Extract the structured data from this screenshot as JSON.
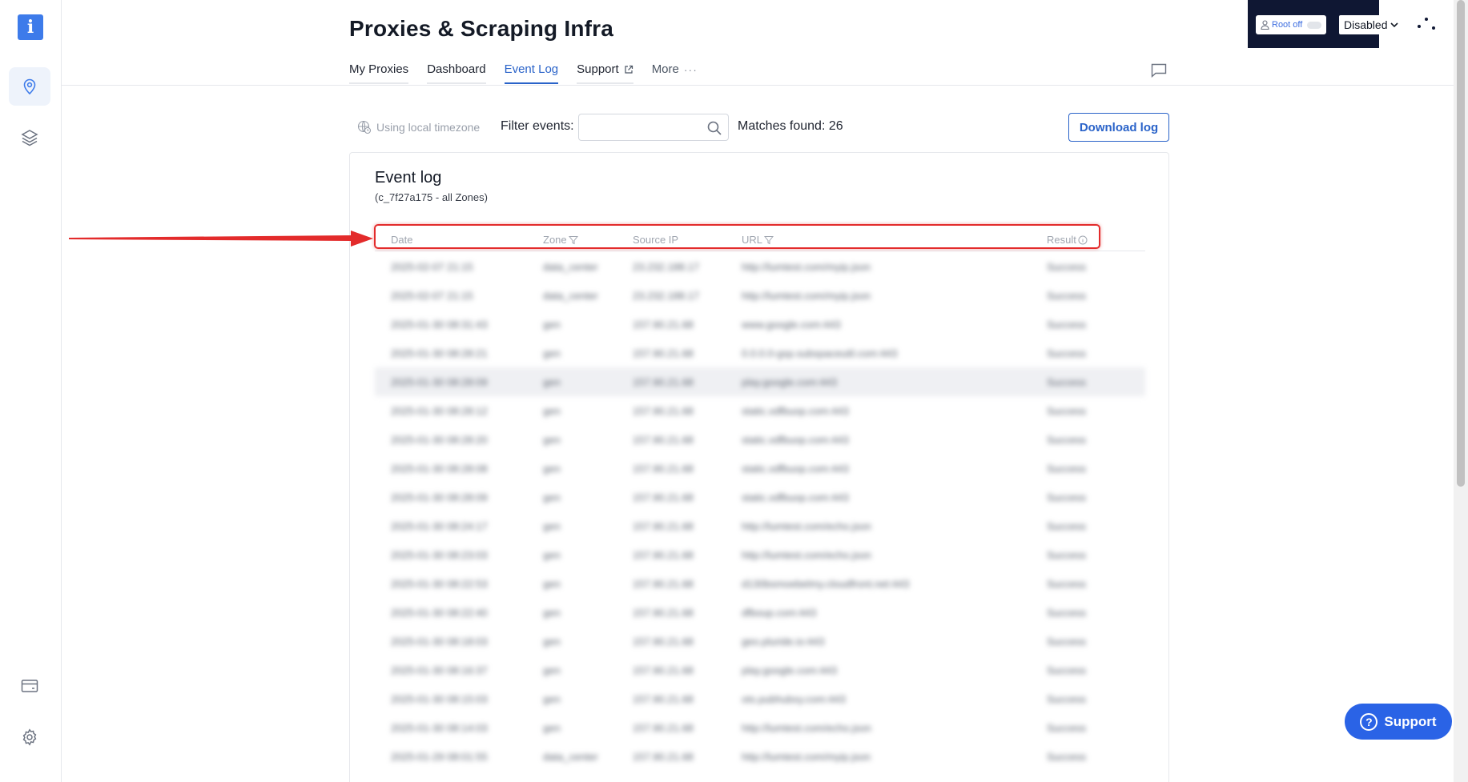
{
  "header": {
    "title": "Proxies & Scraping Infra",
    "tabs": [
      {
        "label": "My Proxies"
      },
      {
        "label": "Dashboard"
      },
      {
        "label": "Event Log"
      },
      {
        "label": "Support"
      },
      {
        "label": "More"
      }
    ]
  },
  "dev_widget": {
    "root_label": "Root off",
    "select_value": "Disabled"
  },
  "toolbar": {
    "timezone_label": "Using local timezone",
    "filter_label": "Filter events:",
    "filter_value": "",
    "matches_label": "Matches found: 26",
    "download_label": "Download log"
  },
  "event_log": {
    "title": "Event log",
    "subtitle": "(c_7f27a175 - all Zones)",
    "columns": [
      "Date",
      "Zone",
      "Source IP",
      "URL",
      "Result"
    ],
    "rows": [
      [
        "2025-02-07 21:15",
        "data_center",
        "23.232.188.17",
        "http://lumtest.com/myip.json",
        "Success"
      ],
      [
        "2025-02-07 21:15",
        "data_center",
        "23.232.188.17",
        "http://lumtest.com/myip.json",
        "Success"
      ],
      [
        "2025-01-30 08:31:43",
        "gen",
        "157.90.21.68",
        "www.google.com:443",
        "Success"
      ],
      [
        "2025-01-30 08:28:21",
        "gen",
        "157.90.21.68",
        "0.0.0.0-gsp.subspaceutil.com:443",
        "Success"
      ],
      [
        "2025-01-30 08:28:09",
        "gen",
        "157.90.21.68",
        "play.google.com:443",
        "Success"
      ],
      [
        "2025-01-30 08:28:12",
        "gen",
        "157.90.21.68",
        "static.xdfbuop.com:443",
        "Success"
      ],
      [
        "2025-01-30 08:28:20",
        "gen",
        "157.90.21.68",
        "static.xdfbuop.com:443",
        "Success"
      ],
      [
        "2025-01-30 08:28:08",
        "gen",
        "157.90.21.68",
        "static.xdfbuop.com:443",
        "Success"
      ],
      [
        "2025-01-30 08:28:09",
        "gen",
        "157.90.21.68",
        "static.xdfbuop.com:443",
        "Success"
      ],
      [
        "2025-01-30 08:24:17",
        "gen",
        "157.90.21.68",
        "http://lumtest.com/echo.json",
        "Success"
      ],
      [
        "2025-01-30 08:23:03",
        "gen",
        "157.90.21.68",
        "http://lumtest.com/echo.json",
        "Success"
      ],
      [
        "2025-01-30 08:22:53",
        "gen",
        "157.90.21.68",
        "d130bsmoebelmy.cloudfront.net:443",
        "Success"
      ],
      [
        "2025-01-30 08:22:40",
        "gen",
        "157.90.21.68",
        "dfboup.com:443",
        "Success"
      ],
      [
        "2025-01-30 08:18:03",
        "gen",
        "157.90.21.68",
        "geo.pluride.io:443",
        "Success"
      ],
      [
        "2025-01-30 08:16:37",
        "gen",
        "157.90.21.68",
        "play.google.com:443",
        "Success"
      ],
      [
        "2025-01-30 08:15:03",
        "gen",
        "157.90.21.68",
        "ots.pubhubxy.com:443",
        "Success"
      ],
      [
        "2025-01-30 08:14:03",
        "gen",
        "157.90.21.68",
        "http://lumtest.com/echo.json",
        "Success"
      ],
      [
        "2025-01-29 08:01:55",
        "data_center",
        "157.90.21.68",
        "http://lumtest.com/myip.json",
        "Success"
      ]
    ]
  },
  "support_button": {
    "label": "Support"
  },
  "colors": {
    "accent": "#2a63c9",
    "highlight": "#e32b2b",
    "dev_widget_bg": "#0f1733"
  }
}
